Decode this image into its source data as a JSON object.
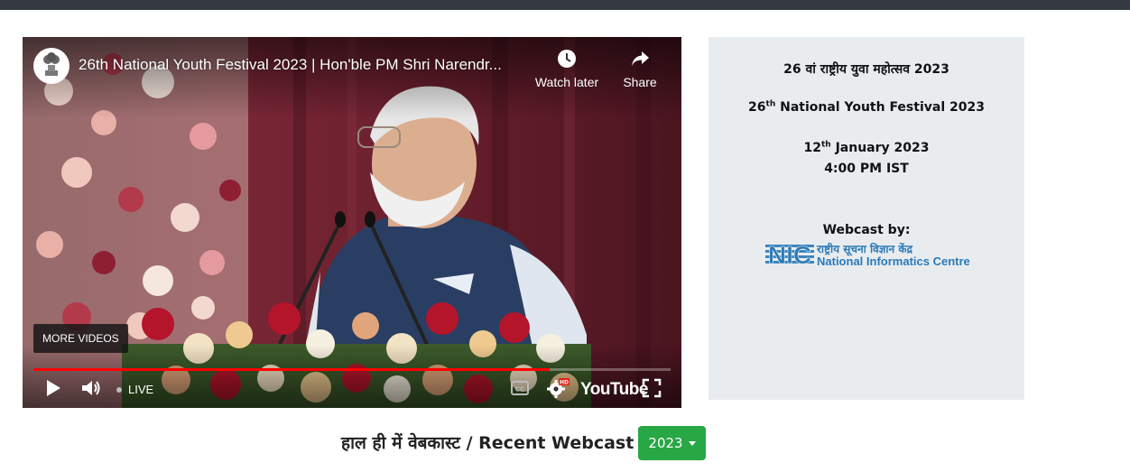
{
  "player": {
    "title": "26th National Youth Festival 2023 | Hon'ble PM Shri Narendr...",
    "watch_later_label": "Watch later",
    "share_label": "Share",
    "more_videos_label": "MORE VIDEOS",
    "live_label": "LIVE",
    "brand_label": "YouTube",
    "progress_fraction": 0.81,
    "hd_badge": "HD",
    "icons": [
      "emblem-icon",
      "clock-icon",
      "share-icon",
      "play-icon",
      "volume-icon",
      "captions-icon",
      "settings-icon",
      "fullscreen-icon"
    ]
  },
  "info": {
    "hindi_title": "26 वां राष्ट्रीय युवा महोत्सव 2023",
    "english_title_prefix": "26",
    "english_title_sup": "th",
    "english_title_suffix": " National Youth Festival 2023",
    "date_prefix": "12",
    "date_sup": "th",
    "date_suffix": " January 2023",
    "time": "4:00 PM IST",
    "webcast_by": "Webcast by:",
    "nic_logo": {
      "abbr": "NIC",
      "hindi_name": "राष्ट्रीय सूचना विज्ञान केंद्र",
      "english_name": "National Informatics Centre",
      "color": "#2a7ab8"
    }
  },
  "recent": {
    "heading": "हाल ही में वेबकास्ट / Recent Webcast",
    "year_button": "2023",
    "button_color": "#28a745"
  }
}
